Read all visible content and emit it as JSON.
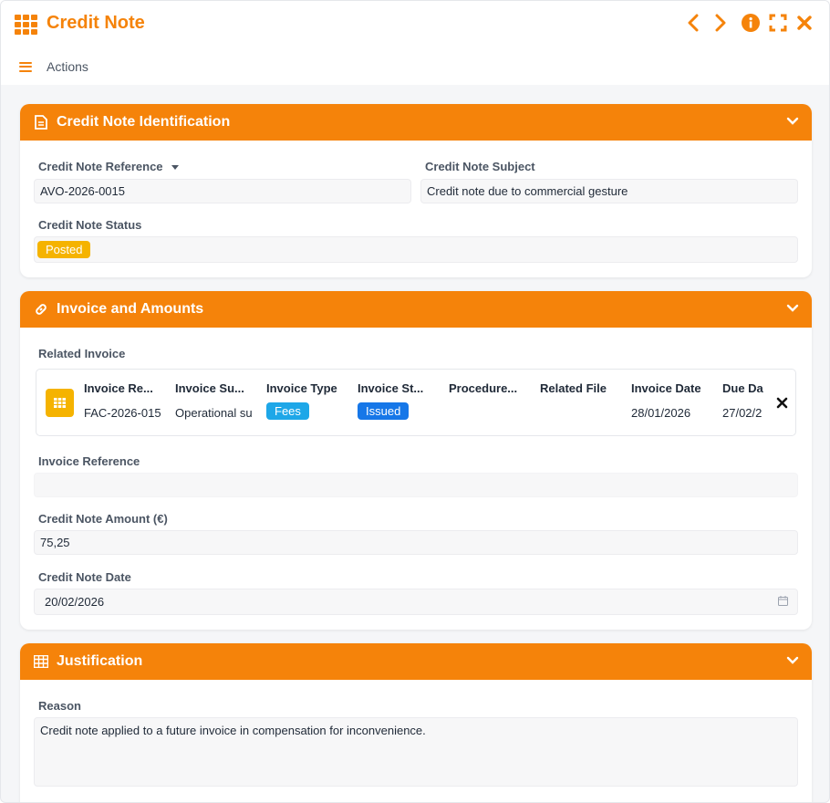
{
  "window": {
    "title": "Credit Note",
    "controls": [
      "chevron-left-icon",
      "chevron-right-icon",
      "info-icon",
      "expand-icon",
      "close-icon"
    ]
  },
  "toolbar": {
    "actions_label": "Actions"
  },
  "colors": {
    "accent": "#f5830a",
    "badge_posted": "#f5b300",
    "badge_fees": "#1ea7e8",
    "badge_issued": "#1677e8"
  },
  "identification": {
    "title": "Credit Note Identification",
    "reference_label": "Credit Note Reference",
    "reference_value": "AVO-2026-0015",
    "subject_label": "Credit Note Subject",
    "subject_value": "Credit note due to commercial gesture",
    "status_label": "Credit Note Status",
    "status_value": "Posted"
  },
  "invoice": {
    "title": "Invoice and Amounts",
    "related_label": "Related Invoice",
    "columns": [
      "Invoice Re...",
      "Invoice Su...",
      "Invoice Type",
      "Invoice St...",
      "Procedure...",
      "Related File",
      "Invoice Date",
      "Due Da"
    ],
    "row": {
      "reference": "FAC-2026-015",
      "subject": "Operational su",
      "type": "Fees",
      "status": "Issued",
      "procedure": "",
      "related_file": "",
      "invoice_date": "28/01/2026",
      "due_date": "27/02/2"
    },
    "reference_label": "Invoice Reference",
    "reference_value": "",
    "amount_label": "Credit Note Amount (€)",
    "amount_value": "75,25",
    "date_label": "Credit Note Date",
    "date_value": "20/02/2026"
  },
  "justification": {
    "title": "Justification",
    "reason_label": "Reason",
    "reason_value": "Credit note applied to a future invoice in compensation for inconvenience."
  }
}
